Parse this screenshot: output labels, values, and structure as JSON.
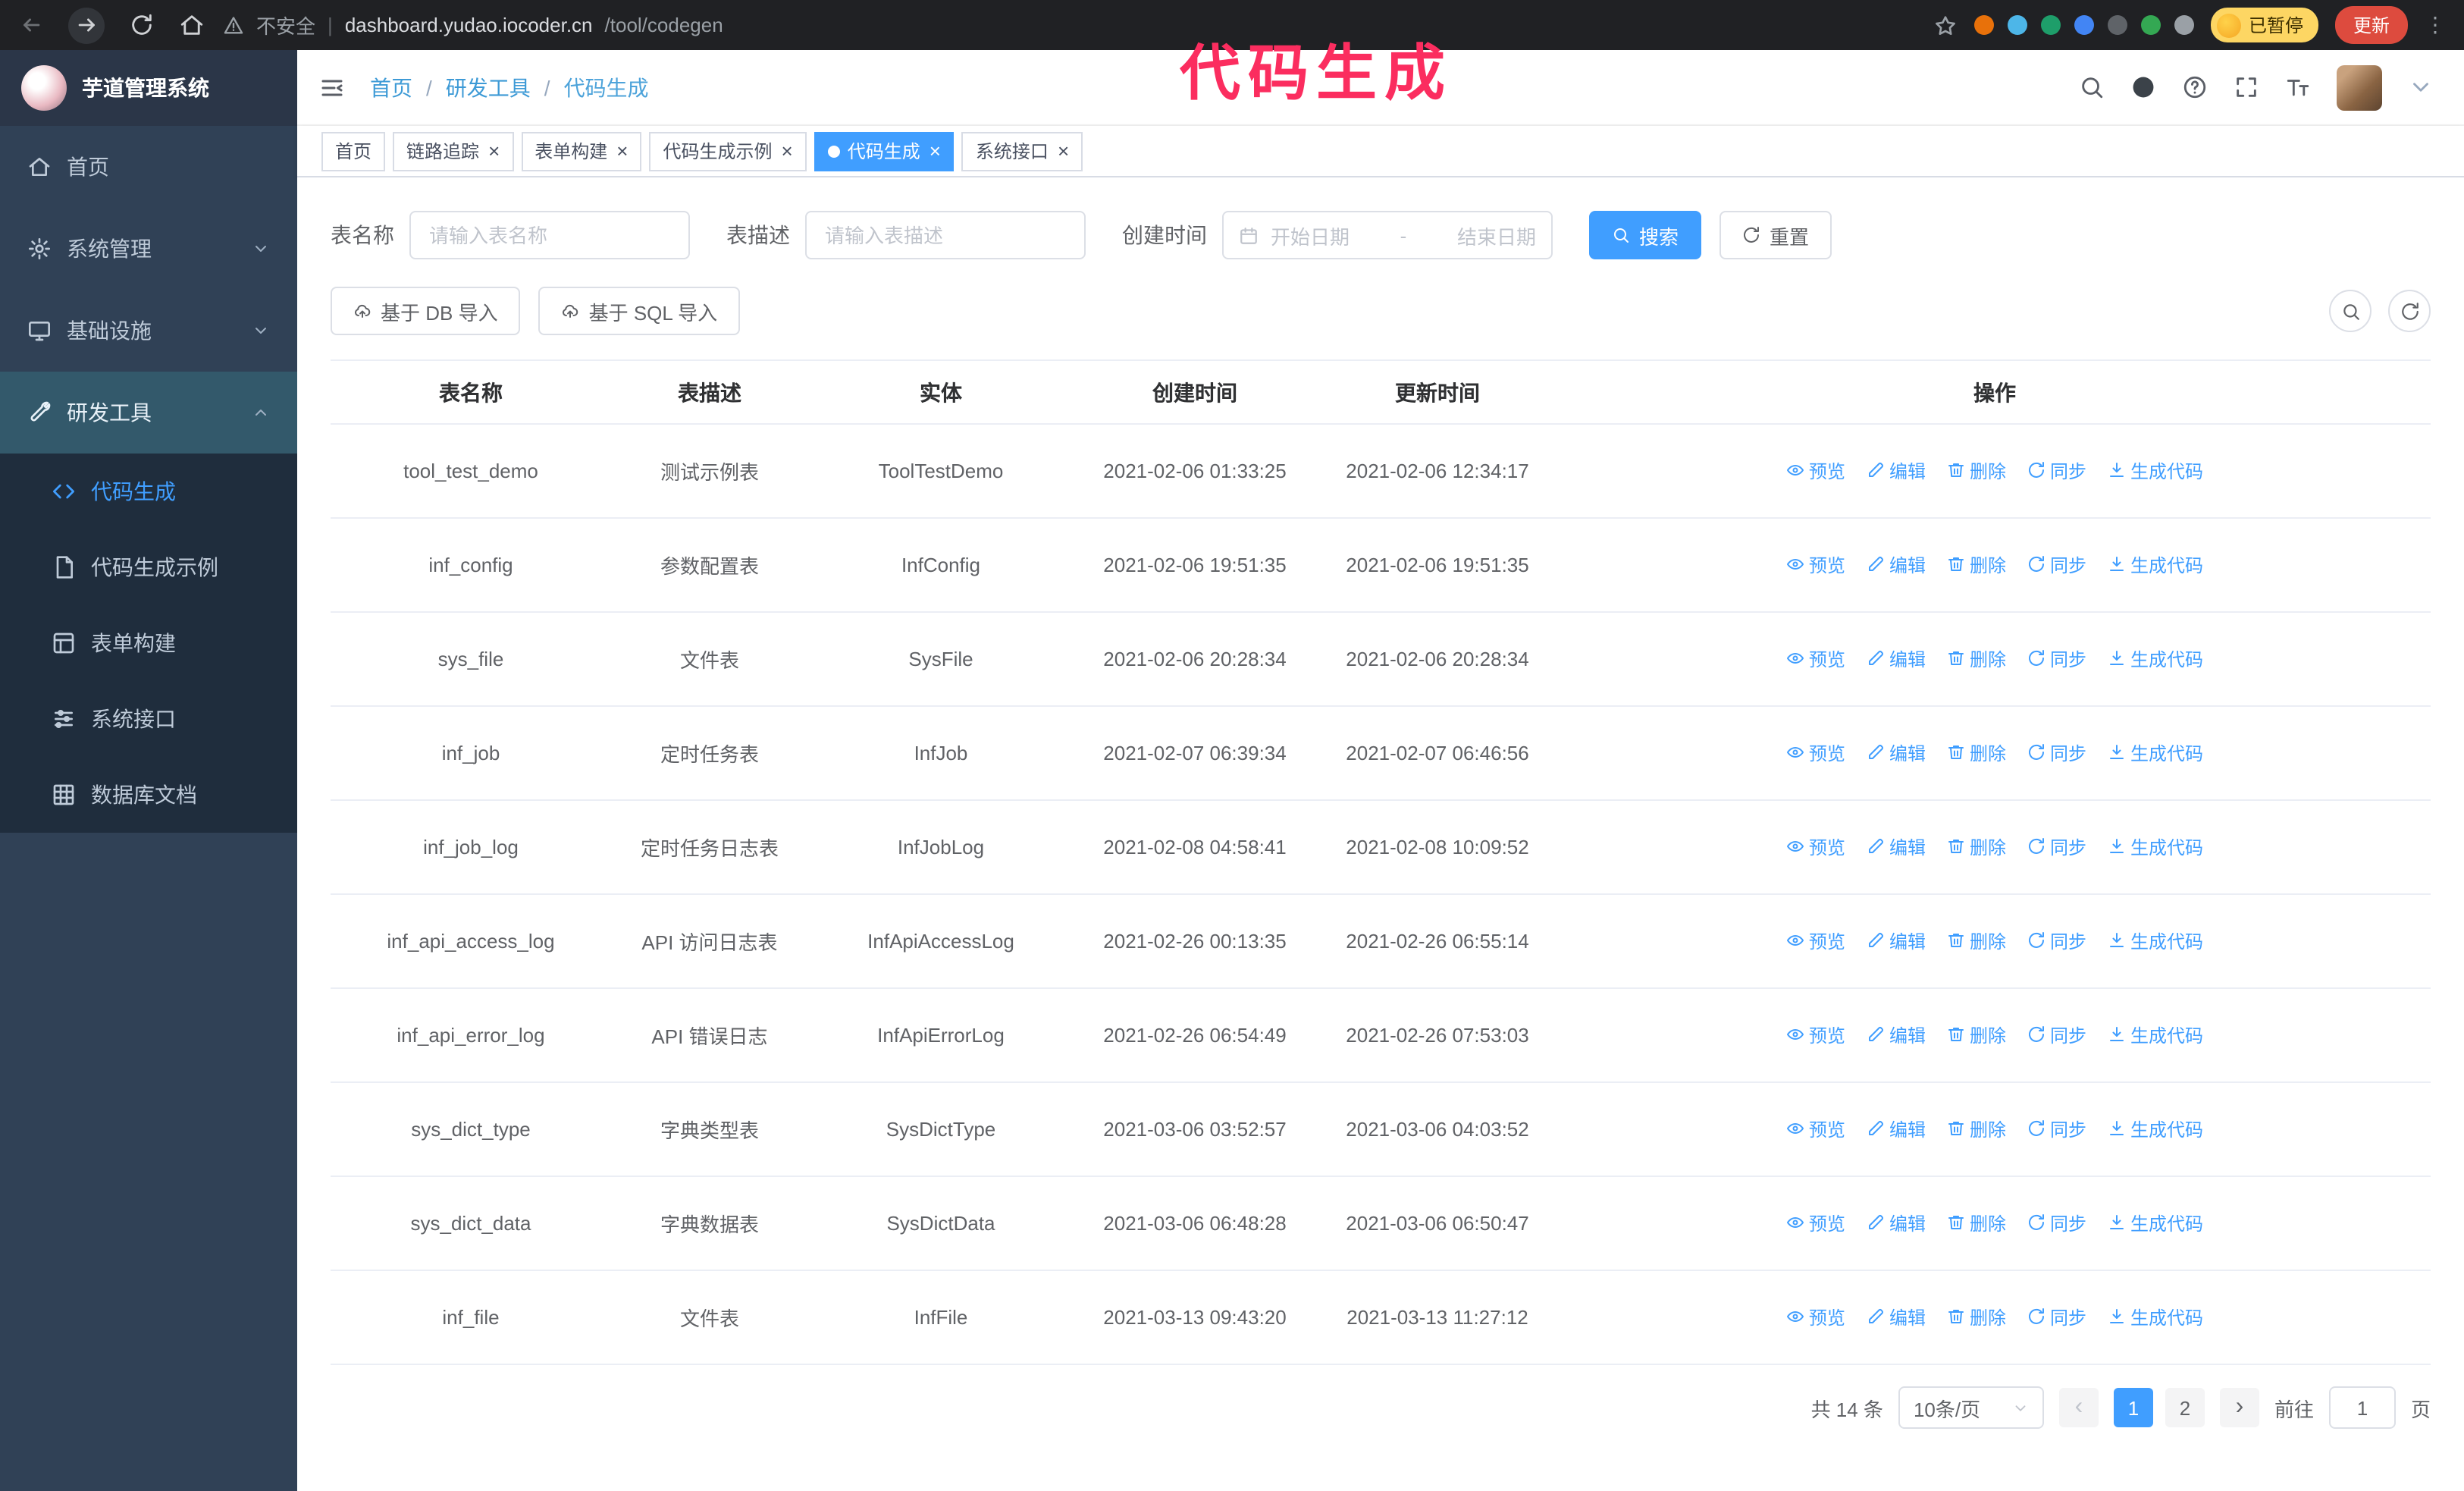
{
  "browser": {
    "security_label": "不安全",
    "url_domain": "dashboard.yudao.iocoder.cn",
    "url_path": "/tool/codegen",
    "paused_badge": "已暂停",
    "update_button": "更新",
    "extension_colors": [
      "#e8710a",
      "#4db6e8",
      "#1e9e6a",
      "#4285f4",
      "#5f6368",
      "#34a853",
      "#9aa0a6"
    ]
  },
  "annotation": {
    "text": "代码生成",
    "color": "#fb2d5f"
  },
  "sidebar": {
    "logo_title": "芋道管理系统",
    "items": [
      {
        "label": "首页",
        "icon": "home",
        "chevron": null,
        "active": false
      },
      {
        "label": "系统管理",
        "icon": "gear",
        "chevron": "down",
        "active": false
      },
      {
        "label": "基础设施",
        "icon": "monitor",
        "chevron": "down",
        "active": false
      },
      {
        "label": "研发工具",
        "icon": "tools",
        "chevron": "up",
        "active": true
      }
    ],
    "submenu": [
      {
        "label": "代码生成",
        "icon": "code",
        "active": true
      },
      {
        "label": "代码生成示例",
        "icon": "doc",
        "active": false
      },
      {
        "label": "表单构建",
        "icon": "form",
        "active": false
      },
      {
        "label": "系统接口",
        "icon": "sliders",
        "active": false
      },
      {
        "label": "数据库文档",
        "icon": "grid",
        "active": false
      }
    ]
  },
  "header": {
    "breadcrumb": [
      "首页",
      "研发工具",
      "代码生成"
    ]
  },
  "tabs": [
    {
      "label": "首页",
      "closable": false,
      "active": false
    },
    {
      "label": "链路追踪",
      "closable": true,
      "active": false
    },
    {
      "label": "表单构建",
      "closable": true,
      "active": false
    },
    {
      "label": "代码生成示例",
      "closable": true,
      "active": false
    },
    {
      "label": "代码生成",
      "closable": true,
      "active": true
    },
    {
      "label": "系统接口",
      "closable": true,
      "active": false
    }
  ],
  "filters": {
    "table_name_label": "表名称",
    "table_name_placeholder": "请输入表名称",
    "table_desc_label": "表描述",
    "table_desc_placeholder": "请输入表描述",
    "create_time_label": "创建时间",
    "date_start_placeholder": "开始日期",
    "date_separator": "-",
    "date_end_placeholder": "结束日期",
    "search_button": "搜索",
    "reset_button": "重置"
  },
  "toolbar": {
    "import_db": "基于 DB 导入",
    "import_sql": "基于 SQL 导入"
  },
  "table": {
    "columns": [
      "表名称",
      "表描述",
      "实体",
      "创建时间",
      "更新时间",
      "操作"
    ],
    "actions": [
      {
        "label": "预览",
        "icon": "eye"
      },
      {
        "label": "编辑",
        "icon": "edit"
      },
      {
        "label": "删除",
        "icon": "trash"
      },
      {
        "label": "同步",
        "icon": "sync"
      },
      {
        "label": "生成代码",
        "icon": "download"
      }
    ],
    "rows": [
      {
        "name": "tool_test_demo",
        "desc": "测试示例表",
        "entity": "ToolTestDemo",
        "created": "2021-02-06 01:33:25",
        "updated": "2021-02-06 12:34:17"
      },
      {
        "name": "inf_config",
        "desc": "参数配置表",
        "entity": "InfConfig",
        "created": "2021-02-06 19:51:35",
        "updated": "2021-02-06 19:51:35"
      },
      {
        "name": "sys_file",
        "desc": "文件表",
        "entity": "SysFile",
        "created": "2021-02-06 20:28:34",
        "updated": "2021-02-06 20:28:34"
      },
      {
        "name": "inf_job",
        "desc": "定时任务表",
        "entity": "InfJob",
        "created": "2021-02-07 06:39:34",
        "updated": "2021-02-07 06:46:56"
      },
      {
        "name": "inf_job_log",
        "desc": "定时任务日志表",
        "entity": "InfJobLog",
        "created": "2021-02-08 04:58:41",
        "updated": "2021-02-08 10:09:52"
      },
      {
        "name": "inf_api_access_log",
        "desc": "API 访问日志表",
        "entity": "InfApiAccessLog",
        "created": "2021-02-26 00:13:35",
        "updated": "2021-02-26 06:55:14"
      },
      {
        "name": "inf_api_error_log",
        "desc": "API 错误日志",
        "entity": "InfApiErrorLog",
        "created": "2021-02-26 06:54:49",
        "updated": "2021-02-26 07:53:03"
      },
      {
        "name": "sys_dict_type",
        "desc": "字典类型表",
        "entity": "SysDictType",
        "created": "2021-03-06 03:52:57",
        "updated": "2021-03-06 04:03:52"
      },
      {
        "name": "sys_dict_data",
        "desc": "字典数据表",
        "entity": "SysDictData",
        "created": "2021-03-06 06:48:28",
        "updated": "2021-03-06 06:50:47"
      },
      {
        "name": "inf_file",
        "desc": "文件表",
        "entity": "InfFile",
        "created": "2021-03-13 09:43:20",
        "updated": "2021-03-13 11:27:12"
      }
    ]
  },
  "pagination": {
    "total_text": "共 14 条",
    "page_size": "10条/页",
    "pages": [
      "1",
      "2"
    ],
    "active_page": "1",
    "prev_arrow": "‹",
    "next_arrow": "›",
    "goto_label": "前往",
    "goto_value": "1",
    "goto_suffix": "页"
  },
  "colors": {
    "primary": "#409eff",
    "sidebar_bg": "#304156",
    "submenu_bg": "#1f2d3d"
  }
}
